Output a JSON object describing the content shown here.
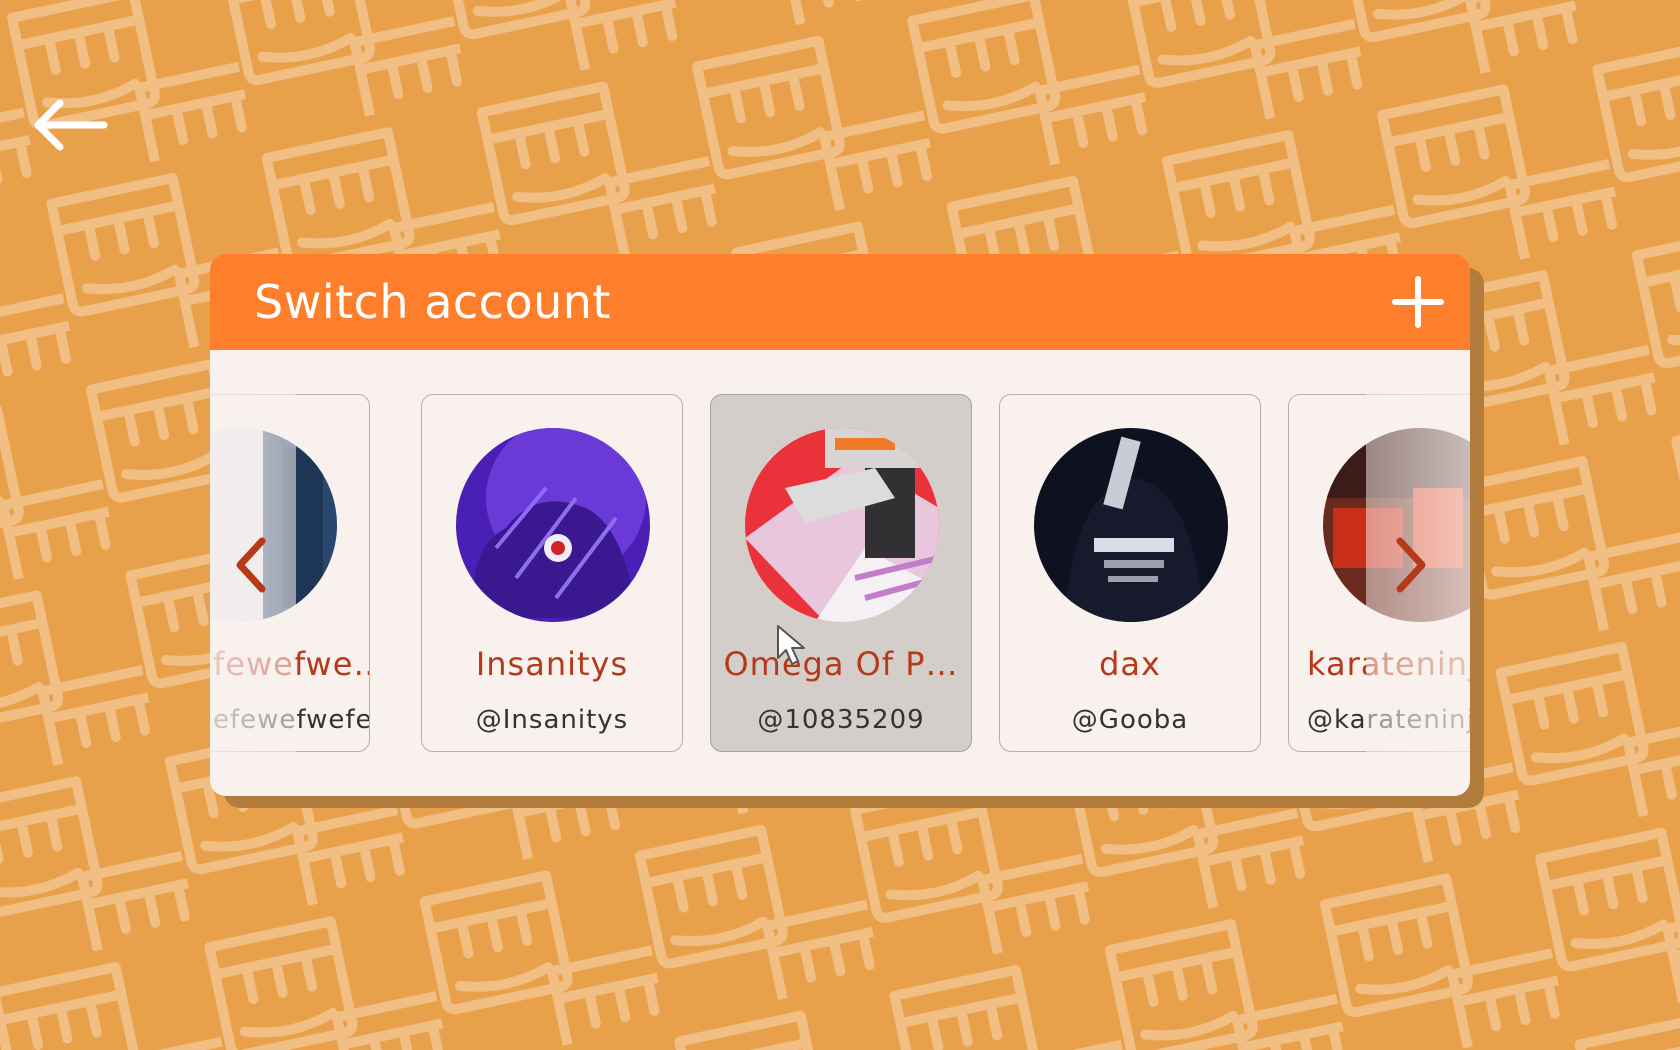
{
  "header": {
    "title": "Switch account",
    "add_icon": "plus-icon",
    "back_icon": "arrow-left-icon"
  },
  "accounts": [
    {
      "name": "fewefwe…",
      "handle": "efewefwefe…",
      "partial": "left"
    },
    {
      "name": "Insanitys",
      "handle": "@Insanitys"
    },
    {
      "name": "Omega Of P…",
      "handle": "@10835209",
      "selected": true
    },
    {
      "name": "dax",
      "handle": "@Gooba"
    },
    {
      "name": "karateninja",
      "handle": "@karateninja",
      "partial": "right"
    }
  ],
  "navigation": {
    "prev_icon": "chevron-left-icon",
    "next_icon": "chevron-right-icon"
  },
  "colors": {
    "background": "#e8a04a",
    "header": "#fd7f2c",
    "panel": "#f9f1ee",
    "name_text": "#b53a1a",
    "selected_card": "#d4cecb"
  }
}
